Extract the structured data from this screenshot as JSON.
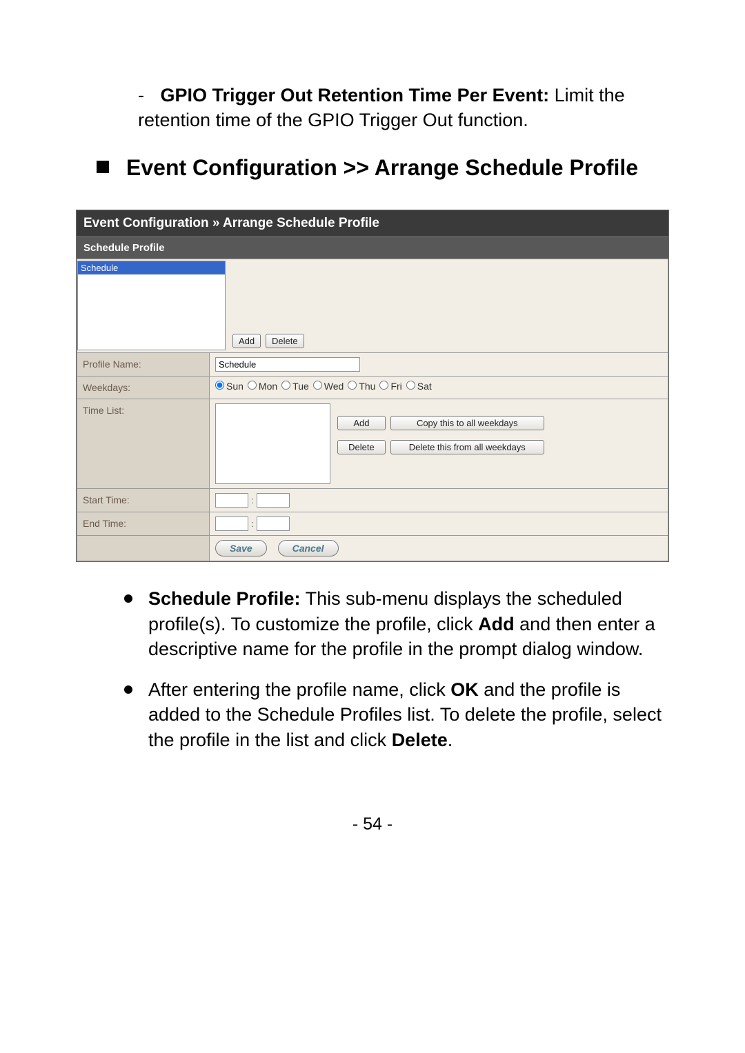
{
  "gpio_item": {
    "label": "GPIO Trigger Out Retention Time Per Event:",
    "text": " Limit the retention time of the GPIO Trigger Out function."
  },
  "heading": "Event Configuration >> Arrange Schedule Profile",
  "panel": {
    "title": "Event Configuration » Arrange Schedule Profile",
    "section": "Schedule Profile",
    "list_item": "Schedule",
    "add": "Add",
    "delete": "Delete",
    "rows": {
      "profile_name_label": "Profile Name:",
      "profile_name_value": "Schedule",
      "weekdays_label": "Weekdays:",
      "weekdays": [
        "Sun",
        "Mon",
        "Tue",
        "Wed",
        "Thu",
        "Fri",
        "Sat"
      ],
      "timelist_label": "Time List:",
      "tl_add": "Add",
      "tl_copy": "Copy this to all weekdays",
      "tl_delete": "Delete",
      "tl_delete_all": "Delete this from all weekdays",
      "start_time_label": "Start Time:",
      "end_time_label": "End Time:"
    },
    "save": "Save",
    "cancel": "Cancel"
  },
  "bullets": {
    "b1_label": "Schedule Profile:",
    "b1_text": " This sub-menu displays the scheduled profile(s). To customize the profile, click ",
    "b1_bold2": "Add",
    "b1_text2": " and then enter a descriptive name for the profile in the prompt dialog window.",
    "b2_text": "After entering the profile name, click ",
    "b2_bold": "OK",
    "b2_text2": " and the profile is added to the Schedule Profiles list. To delete the profile, select the profile in the list and click ",
    "b2_bold2": "Delete",
    "b2_text3": "."
  },
  "page_number": "- 54 -"
}
